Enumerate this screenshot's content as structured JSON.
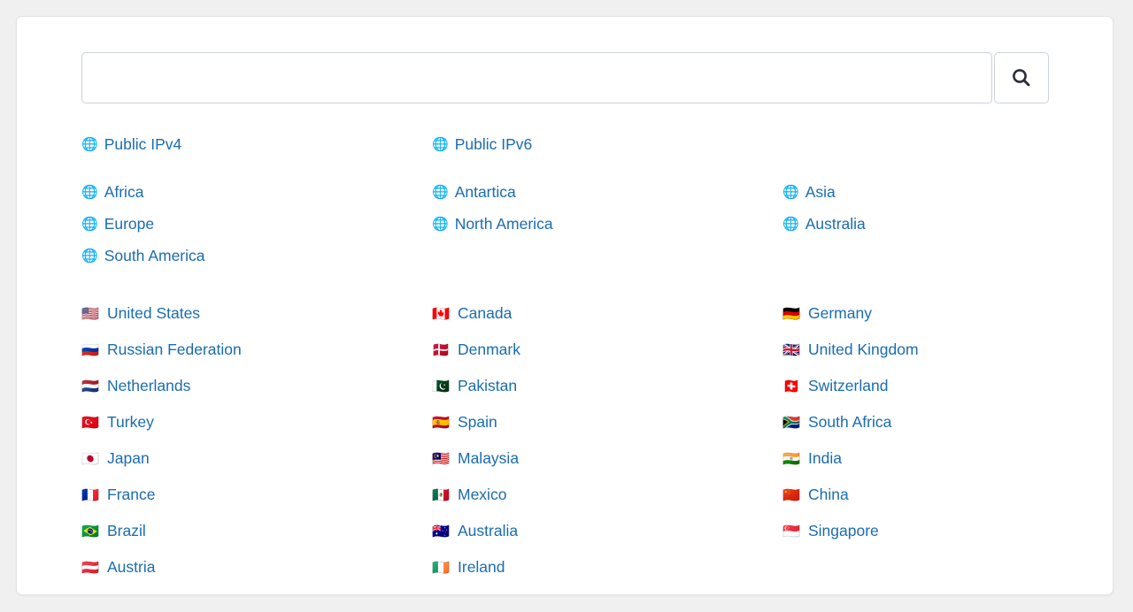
{
  "page": {
    "background_color": "#f0f0f0",
    "card_background": "#ffffff",
    "link_color": "#1a6cb0"
  },
  "search": {
    "value": "",
    "placeholder": "",
    "button_label": "Search",
    "button_icon": "search-icon"
  },
  "ip_links": [
    {
      "label": "Public IPv4",
      "icon": "globe-icon",
      "glyph": "🌐"
    },
    {
      "label": "Public IPv6",
      "icon": "globe-icon",
      "glyph": "🌐"
    },
    {
      "label": "",
      "icon": "",
      "glyph": ""
    }
  ],
  "continents": [
    {
      "label": "Africa",
      "icon": "globe-icon",
      "glyph": "🌐"
    },
    {
      "label": "Antartica",
      "icon": "globe-icon",
      "glyph": "🌐"
    },
    {
      "label": "Asia",
      "icon": "globe-icon",
      "glyph": "🌐"
    },
    {
      "label": "Europe",
      "icon": "globe-icon",
      "glyph": "🌐"
    },
    {
      "label": "North America",
      "icon": "globe-icon",
      "glyph": "🌐"
    },
    {
      "label": "Australia",
      "icon": "globe-icon",
      "glyph": "🌐"
    },
    {
      "label": "South America",
      "icon": "globe-icon",
      "glyph": "🌐"
    },
    {
      "label": "",
      "icon": "",
      "glyph": ""
    },
    {
      "label": "",
      "icon": "",
      "glyph": ""
    }
  ],
  "countries": [
    {
      "label": "United States",
      "icon": "flag-us-icon",
      "glyph": "🇺🇸"
    },
    {
      "label": "Canada",
      "icon": "flag-ca-icon",
      "glyph": "🇨🇦"
    },
    {
      "label": "Germany",
      "icon": "flag-de-icon",
      "glyph": "🇩🇪"
    },
    {
      "label": "Russian Federation",
      "icon": "flag-ru-icon",
      "glyph": "🇷🇺"
    },
    {
      "label": "Denmark",
      "icon": "flag-dk-icon",
      "glyph": "🇩🇰"
    },
    {
      "label": "United Kingdom",
      "icon": "flag-gb-icon",
      "glyph": "🇬🇧"
    },
    {
      "label": "Netherlands",
      "icon": "flag-nl-icon",
      "glyph": "🇳🇱"
    },
    {
      "label": "Pakistan",
      "icon": "flag-pk-icon",
      "glyph": "🇵🇰"
    },
    {
      "label": "Switzerland",
      "icon": "flag-ch-icon",
      "glyph": "🇨🇭"
    },
    {
      "label": "Turkey",
      "icon": "flag-tr-icon",
      "glyph": "🇹🇷"
    },
    {
      "label": "Spain",
      "icon": "flag-es-icon",
      "glyph": "🇪🇸"
    },
    {
      "label": "South Africa",
      "icon": "flag-za-icon",
      "glyph": "🇿🇦"
    },
    {
      "label": "Japan",
      "icon": "flag-jp-icon",
      "glyph": "🇯🇵"
    },
    {
      "label": "Malaysia",
      "icon": "flag-my-icon",
      "glyph": "🇲🇾"
    },
    {
      "label": "India",
      "icon": "flag-in-icon",
      "glyph": "🇮🇳"
    },
    {
      "label": "France",
      "icon": "flag-fr-icon",
      "glyph": "🇫🇷"
    },
    {
      "label": "Mexico",
      "icon": "flag-mx-icon",
      "glyph": "🇲🇽"
    },
    {
      "label": "China",
      "icon": "flag-cn-icon",
      "glyph": "🇨🇳"
    },
    {
      "label": "Brazil",
      "icon": "flag-br-icon",
      "glyph": "🇧🇷"
    },
    {
      "label": "Australia",
      "icon": "flag-au-icon",
      "glyph": "🇦🇺"
    },
    {
      "label": "Singapore",
      "icon": "flag-sg-icon",
      "glyph": "🇸🇬"
    },
    {
      "label": "Austria",
      "icon": "flag-at-icon",
      "glyph": "🇦🇹"
    },
    {
      "label": "Ireland",
      "icon": "flag-ie-icon",
      "glyph": "🇮🇪"
    },
    {
      "label": "",
      "icon": "",
      "glyph": ""
    }
  ]
}
